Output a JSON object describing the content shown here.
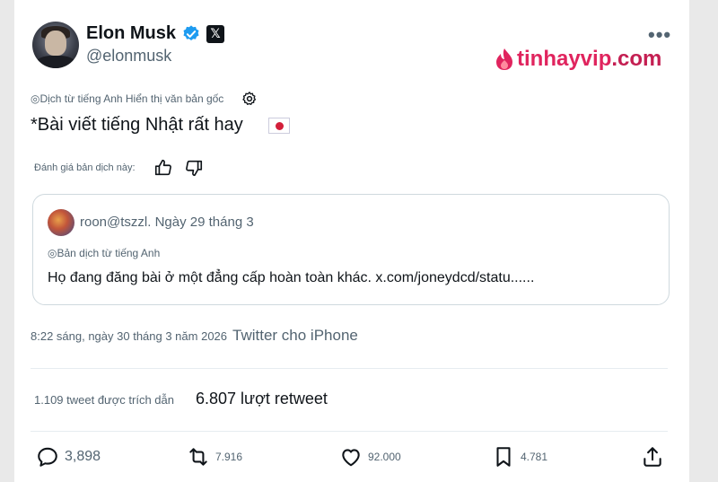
{
  "header": {
    "display_name": "Elon Musk",
    "handle": "@elonmusk",
    "more_label": "•••"
  },
  "watermark": {
    "part_a": "tinhayvip",
    "part_b": ".com"
  },
  "translation": {
    "notice": "◎Dịch từ tiếng Anh Hiển thị văn bản gốc"
  },
  "post": {
    "text": "*Bài viết tiếng Nhật rất hay"
  },
  "rating": {
    "label": "Đánh giá bản dịch này:"
  },
  "quote": {
    "header": "roon@tszzl. Ngày 29 tháng 3",
    "translate_notice": "◎Bản dịch từ tiếng Anh",
    "text": "Họ đang đăng bài ở một đẳng cấp hoàn toàn khác. x.com/joneydcd/statu......"
  },
  "meta": {
    "time": "8:22 sáng, ngày 30 tháng 3 năm 2026",
    "source": "Twitter cho iPhone"
  },
  "stats": {
    "quotes": "1.109 tweet được trích dẫn",
    "retweets": "6.807 lượt retweet"
  },
  "actions": {
    "replies": "3,898",
    "reposts": "7.916",
    "likes": "92.000",
    "bookmarks": "4.781"
  },
  "colors": {
    "verified": "#1d9bf0",
    "watermark_brand": "#e0245e"
  }
}
